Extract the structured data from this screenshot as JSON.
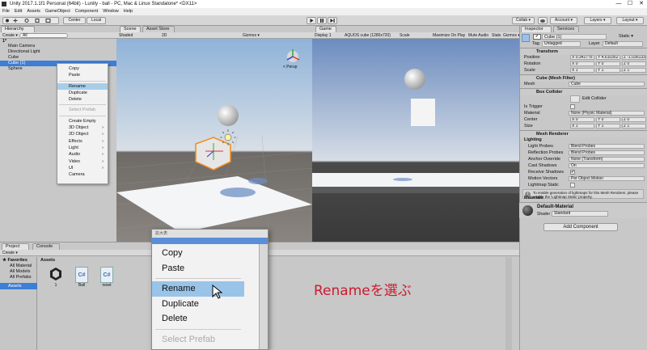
{
  "window": {
    "title": "Unity 2017.1.1f1 Personal (64bit) - Lunity - ball - PC, Mac & Linux Standalone* <DX11>",
    "minimize": "—",
    "maximize": "☐",
    "close": "✕"
  },
  "menubar": [
    "File",
    "Edit",
    "Assets",
    "GameObject",
    "Component",
    "Window",
    "Help"
  ],
  "toolbar": {
    "center": "Center",
    "local": "Local",
    "collab": "Collab ▾",
    "account": "Account ▾",
    "layers": "Layers ▾",
    "layout": "Layout ▾"
  },
  "hierarchy": {
    "tab": "Hierarchy",
    "create": "Create ▾",
    "search": "All",
    "scene": "1*",
    "items": [
      "Main Camera",
      "Directional Light",
      "Cube",
      "Cube (1)",
      "Sphere"
    ]
  },
  "context_menu": {
    "items": [
      {
        "label": "Copy"
      },
      {
        "label": "Paste"
      },
      {
        "sep": true
      },
      {
        "label": "Rename",
        "selected": true
      },
      {
        "label": "Duplicate"
      },
      {
        "label": "Delete"
      },
      {
        "sep": true
      },
      {
        "label": "Select Prefab",
        "disabled": true
      },
      {
        "sep": true
      },
      {
        "label": "Create Empty"
      },
      {
        "label": "3D Object",
        "sub": true
      },
      {
        "label": "2D Object",
        "sub": true
      },
      {
        "label": "Effects",
        "sub": true
      },
      {
        "label": "Light",
        "sub": true
      },
      {
        "label": "Audio",
        "sub": true
      },
      {
        "label": "Video",
        "sub": true
      },
      {
        "label": "UI",
        "sub": true
      },
      {
        "label": "Camera"
      }
    ]
  },
  "scene": {
    "tab": "Scene",
    "asset_store": "Asset Store",
    "shading": "Shaded",
    "mode": "2D",
    "gizmos": "Gizmos ▾",
    "persp": "< Persp"
  },
  "game": {
    "tab": "Game",
    "display": "Display 1",
    "resolution": "AQUOS cube (1280x720)",
    "scale": "Scale",
    "maximize": "Maximize On Play",
    "mute": "Mute Audio",
    "stats": "Stats",
    "gizmos": "Gizmos ▾"
  },
  "inspector": {
    "tab": "Inspector",
    "services": "Services",
    "name": "Cube (1)",
    "static": "Static ▾",
    "tag_label": "Tag",
    "tag": "Untagged",
    "layer_label": "Layer",
    "layer": "Default",
    "transform": "Transform",
    "position": "Position",
    "rotation": "Rotation",
    "scale": "Scale",
    "pos": [
      "X 0.342776",
      "Y 4.610352",
      "Z -1.036133"
    ],
    "rot": [
      "X 0",
      "Y 0",
      "Z 0"
    ],
    "scl": [
      "X 1",
      "Y 1",
      "Z 1"
    ],
    "mesh_filter": "Cube (Mesh Filter)",
    "mesh_label": "Mesh",
    "mesh": "Cube",
    "box_collider": "Box Collider",
    "edit_collider": "Edit Collider",
    "is_trigger": "Is Trigger",
    "material_label": "Material",
    "material": "None (Physic Material)",
    "center": "Center",
    "size": "Size",
    "ctr": [
      "X 0",
      "Y 0",
      "Z 0"
    ],
    "sz": [
      "X 1",
      "Y 1",
      "Z 1"
    ],
    "mesh_renderer": "Mesh Renderer",
    "lighting": "Lighting",
    "light_probes": "Light Probes",
    "light_probes_v": "Blend Probes",
    "reflection_probes": "Reflection Probes",
    "reflection_probes_v": "Blend Probes",
    "anchor_override": "Anchor Override",
    "anchor_override_v": "None (Transform)",
    "cast_shadows": "Cast Shadows",
    "cast_shadows_v": "On",
    "receive_shadows": "Receive Shadows",
    "motion_vectors": "Motion Vectors",
    "motion_vectors_v": "Per Object Motion",
    "lightmap_static": "Lightmap Static",
    "info": "To enable generation of lightmaps for this Mesh Renderer, please enable the 'Lightmap Static' property.",
    "materials": "Materials",
    "default_material": "Default-Material",
    "shader_label": "Shader",
    "shader": "Standard",
    "add_component": "Add Component"
  },
  "project": {
    "tab": "Project",
    "console": "Console",
    "create": "Create ▾",
    "favorites": "Favorites",
    "fav_items": [
      "All Material",
      "All Models",
      "All Prefabs"
    ],
    "assets_root": "Assets",
    "assets_header": "Assets",
    "assets": [
      {
        "name": "1",
        "kind": "unity"
      },
      {
        "name": "Ball",
        "kind": "cs"
      },
      {
        "name": "reset",
        "kind": "cs"
      }
    ]
  },
  "zoom": {
    "header": "拡大表",
    "items": [
      {
        "label": "Copy"
      },
      {
        "label": "Paste"
      },
      {
        "sep": true
      },
      {
        "label": "Rename",
        "selected": true
      },
      {
        "label": "Duplicate"
      },
      {
        "label": "Delete"
      },
      {
        "sep": true
      },
      {
        "label": "Select Prefab",
        "disabled": true
      }
    ]
  },
  "annotation": {
    "text": "Renameを選ぶ",
    "color": "#cc1a2e"
  }
}
